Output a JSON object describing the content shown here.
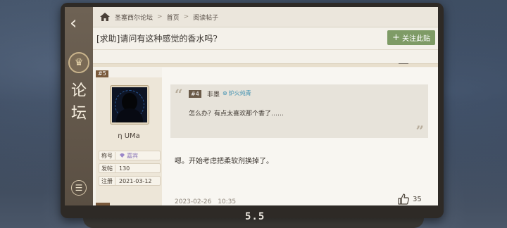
{
  "breadcrumb": {
    "forum": "圣塞西尔论坛",
    "home": "首页",
    "current": "阅读帖子"
  },
  "sidebar": {
    "title": "论坛",
    "back_icon": "chevron-left-icon",
    "menu_icon": "list-icon"
  },
  "post": {
    "title": "[求助]请问有这种感觉的香水吗?",
    "follow_label": "关注此贴",
    "floor": "#5",
    "author": {
      "name": "η UMa",
      "title_key": "称号",
      "title_value": "嘉宾",
      "posts_key": "发帖",
      "posts_value": "130",
      "joined_key": "注册",
      "joined_value": "2021-03-12"
    },
    "quote": {
      "floor": "#4",
      "author": "非墨",
      "badge": "炉火纯青",
      "text": "怎么办？有点太喜欢那个香了……"
    },
    "body": "嗯。开始考虑把柔软剂换掉了。",
    "date": "2023-02-26",
    "time": "10:35",
    "likes": "35"
  },
  "device": {
    "logo": "5.5"
  },
  "colors": {
    "accent_green": "#7e9b66",
    "floor_tag": "#7a5a3c",
    "badge_blue": "#3c8fb0"
  }
}
